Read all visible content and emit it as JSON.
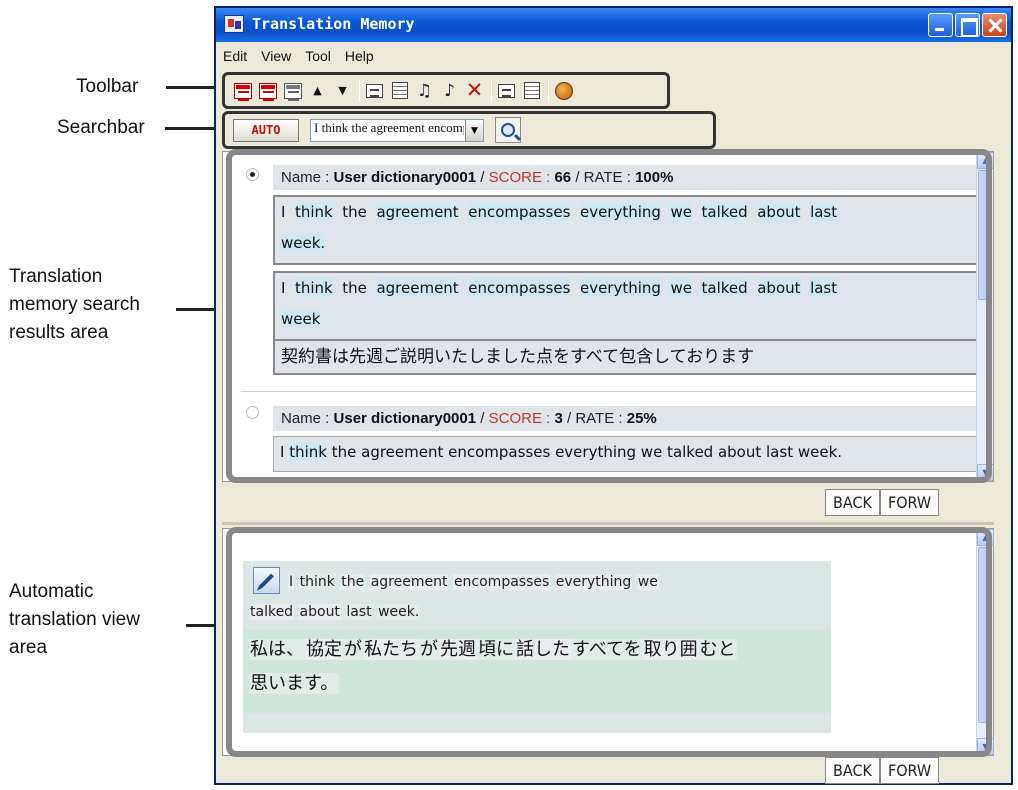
{
  "callouts": {
    "toolbar": "Toolbar",
    "searchbar": "Searchbar",
    "results_lines": [
      "Translation",
      "memory search",
      "results area"
    ],
    "auto_lines": [
      "Automatic",
      "translation view",
      "area"
    ]
  },
  "window": {
    "title": "Translation Memory"
  },
  "menubar": {
    "items": [
      "Edit",
      "View",
      "Tool",
      "Help"
    ]
  },
  "searchbar": {
    "auto_label": "AUTO",
    "query": "I think the agreement encompasses everything w"
  },
  "results": [
    {
      "name_label": "Name : ",
      "name": "User dictionary0001",
      "score_label": "SCORE : ",
      "score": "66",
      "rate_label": "RATE : ",
      "rate": "100%",
      "source_line1": [
        "I",
        "think",
        "the",
        "agreement",
        "encompasses",
        "everything",
        "we",
        "talked",
        "about",
        "last"
      ],
      "source_line2": "week.",
      "target_line1": [
        "I",
        "think",
        "the",
        "agreement",
        "encompasses",
        "everything",
        "we",
        "talked",
        "about",
        "last"
      ],
      "target_line2": "week",
      "translation": "契約書は先週ご説明いたしました点をすべて包含しております"
    },
    {
      "name_label": "Name : ",
      "name": "User dictionary0001",
      "score_label": "SCORE : ",
      "score": "3",
      "rate_label": "RATE : ",
      "rate": "25%",
      "source_word": "I",
      "source_hl": "think",
      "source_rest": "the agreement encompasses everything we talked about last week."
    }
  ],
  "nav": {
    "back": "BACK",
    "forward": "FORW"
  },
  "auto_translation": {
    "source_line1": [
      "I",
      "think",
      "the",
      "agreement",
      "encompasses",
      "everything",
      "we"
    ],
    "source_line2": [
      "talked",
      "about",
      "last",
      "week."
    ],
    "target_line1": [
      "私は、",
      "協定",
      "が",
      "私たち",
      "が",
      "先週",
      "頃に",
      "話した",
      "すべてを",
      "取り囲",
      "むと"
    ],
    "target_line2": "思います。"
  },
  "colors": {
    "titlebar": "#0b4fc7",
    "score": "#c0392b",
    "highlight": "#cde8f3",
    "callout_frame": "#888888"
  },
  "icons": [
    "red-table-icon",
    "red-table-icon",
    "gray-table-icon",
    "up-triangle-icon",
    "down-triangle-icon",
    "document-icon",
    "grid-icon",
    "note-icon",
    "note-edit-icon",
    "delete-x-icon",
    "small-document-icon",
    "list-icon",
    "book-icon"
  ]
}
